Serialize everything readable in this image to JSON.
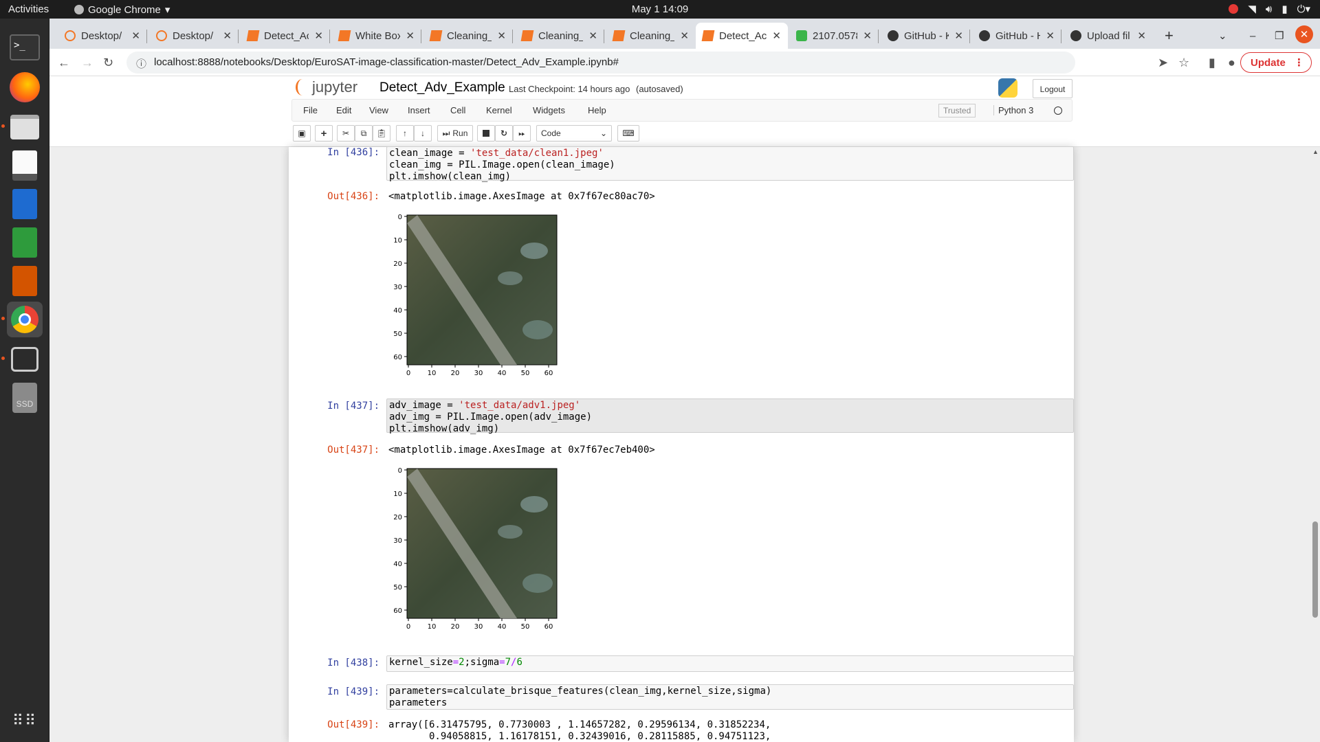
{
  "topbar": {
    "activities": "Activities",
    "app": "Google Chrome",
    "clock": "May 1  14:09"
  },
  "tabs": [
    {
      "title": "Desktop/",
      "icon": "jupyter-icon"
    },
    {
      "title": "Desktop/",
      "icon": "jupyter-icon"
    },
    {
      "title": "Detect_Ac",
      "icon": "notebook-icon"
    },
    {
      "title": "White Box",
      "icon": "notebook-icon"
    },
    {
      "title": "Cleaning_",
      "icon": "notebook-icon"
    },
    {
      "title": "Cleaning_",
      "icon": "notebook-icon"
    },
    {
      "title": "Cleaning_",
      "icon": "notebook-icon"
    },
    {
      "title": "Detect_Ac",
      "icon": "notebook-icon",
      "active": true
    },
    {
      "title": "2107.0578",
      "icon": "overleaf-icon"
    },
    {
      "title": "GitHub - K",
      "icon": "github-icon"
    },
    {
      "title": "GitHub - H",
      "icon": "github-icon"
    },
    {
      "title": "Upload fil",
      "icon": "github-icon"
    }
  ],
  "browser": {
    "url": "localhost:8888/notebooks/Desktop/EuroSAT-image-classification-master/Detect_Adv_Example.ipynb#",
    "update": "Update"
  },
  "jupyter": {
    "logo": "jupyter",
    "notebook": "Detect_Adv_Example",
    "checkpoint": "Last Checkpoint: 14 hours ago",
    "saved": "(autosaved)",
    "logout": "Logout",
    "trusted": "Trusted",
    "kernel": "Python 3",
    "menu": [
      "File",
      "Edit",
      "View",
      "Insert",
      "Cell",
      "Kernel",
      "Widgets",
      "Help"
    ],
    "run": "Run",
    "celltype": "Code"
  },
  "cells": {
    "c436": {
      "in": "In [436]:",
      "out": "Out[436]:",
      "l1a": "clean_image = ",
      "l1b": "'test_data/clean1.jpeg'",
      "l2": "clean_img = PIL.Image.open(clean_image)",
      "l3": "plt.imshow(clean_img)",
      "result": "<matplotlib.image.AxesImage at 0x7f67ec80ac70>"
    },
    "c437": {
      "in": "In [437]:",
      "out": "Out[437]:",
      "l1a": "adv_image = ",
      "l1b": "'test_data/adv1.jpeg'",
      "l2": "adv_img = PIL.Image.open(adv_image)",
      "l3": "plt.imshow(adv_img)",
      "result": "<matplotlib.image.AxesImage at 0x7f67ec7eb400>"
    },
    "c438": {
      "in": "In [438]:",
      "a": "kernel_size",
      "b": "2",
      "c": ";sigma",
      "d": "7",
      "e": "6"
    },
    "c439": {
      "in": "In [439]:",
      "out": "Out[439]:",
      "l1": "parameters=calculate_brisque_features(clean_img,kernel_size,sigma)",
      "l2": "parameters",
      "r1": "array([6.31475795, 0.7730003 , 1.14657282, 0.29596134, 0.31852234,",
      "r2": "       0.94058815, 1.16178151, 0.32439016, 0.28115885, 0.94751123,"
    }
  },
  "axes": {
    "yticks": [
      "0",
      "10",
      "20",
      "30",
      "40",
      "50",
      "60"
    ],
    "xticks": [
      "0",
      "10",
      "20",
      "30",
      "40",
      "50",
      "60"
    ]
  }
}
